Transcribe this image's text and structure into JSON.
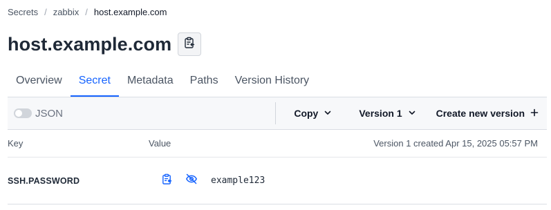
{
  "breadcrumb": {
    "items": [
      "Secrets",
      "zabbix",
      "host.example.com"
    ],
    "separator": "/"
  },
  "header": {
    "title": "host.example.com",
    "copy_icon": "clipboard-copy-icon"
  },
  "tabs": [
    {
      "label": "Overview",
      "active": false
    },
    {
      "label": "Secret",
      "active": true
    },
    {
      "label": "Metadata",
      "active": false
    },
    {
      "label": "Paths",
      "active": false
    },
    {
      "label": "Version History",
      "active": false
    }
  ],
  "toolbar": {
    "json_toggle_label": "JSON",
    "json_toggle_on": false,
    "copy_label": "Copy",
    "version_label": "Version 1",
    "create_label": "Create new version",
    "create_icon": "plus-icon",
    "dropdown_icon": "chevron-down-icon"
  },
  "table": {
    "headers": {
      "key": "Key",
      "value": "Value",
      "meta": "Version 1 created Apr 15, 2025 05:57 PM"
    },
    "rows": [
      {
        "key": "SSH.PASSWORD",
        "value": "example123",
        "copy_icon": "clipboard-copy-icon",
        "visibility_icon": "eye-slash-icon"
      }
    ]
  },
  "colors": {
    "accent": "#1563ff",
    "text": "#1f2937",
    "muted": "#4b5563",
    "toolbar_bg": "#f7f8fa",
    "border": "#d9dde3"
  }
}
